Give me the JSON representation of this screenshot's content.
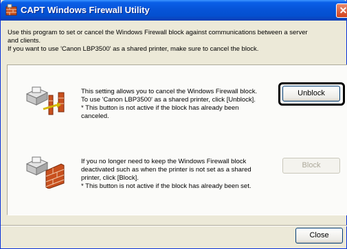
{
  "window": {
    "title": "CAPT Windows Firewall Utility",
    "close_glyph": "✕"
  },
  "intro": {
    "line1": "Use this program to set or cancel the Windows Firewall block against communications between a server",
    "line2": "and clients.",
    "line3": "If you want to use 'Canon LBP3500' as a shared printer, make sure to cancel the block."
  },
  "unblock_section": {
    "icon": "firewall-open-icon",
    "line1": "This setting allows you to cancel the Windows Firewall block.",
    "line2": "To use 'Canon LBP3500' as a shared printer, click [Unblock].",
    "line3": "* This button is not active if the block has already been",
    "line4": "canceled.",
    "button_label": "Unblock",
    "button_enabled": true
  },
  "block_section": {
    "icon": "firewall-closed-icon",
    "line1": "If you no longer need to keep the Windows Firewall block",
    "line2": "deactivated such as when the printer is not set as a shared",
    "line3": "printer, click [Block].",
    "line4": "* This button is not active if the block has already been set.",
    "button_label": "Block",
    "button_enabled": false
  },
  "footer": {
    "close_label": "Close"
  },
  "colors": {
    "titlebar": "#0654d8",
    "window_bg": "#ece9d8",
    "panel_bg": "#fbfbf9",
    "close_button": "#d1421c",
    "brick": "#c8501e"
  }
}
